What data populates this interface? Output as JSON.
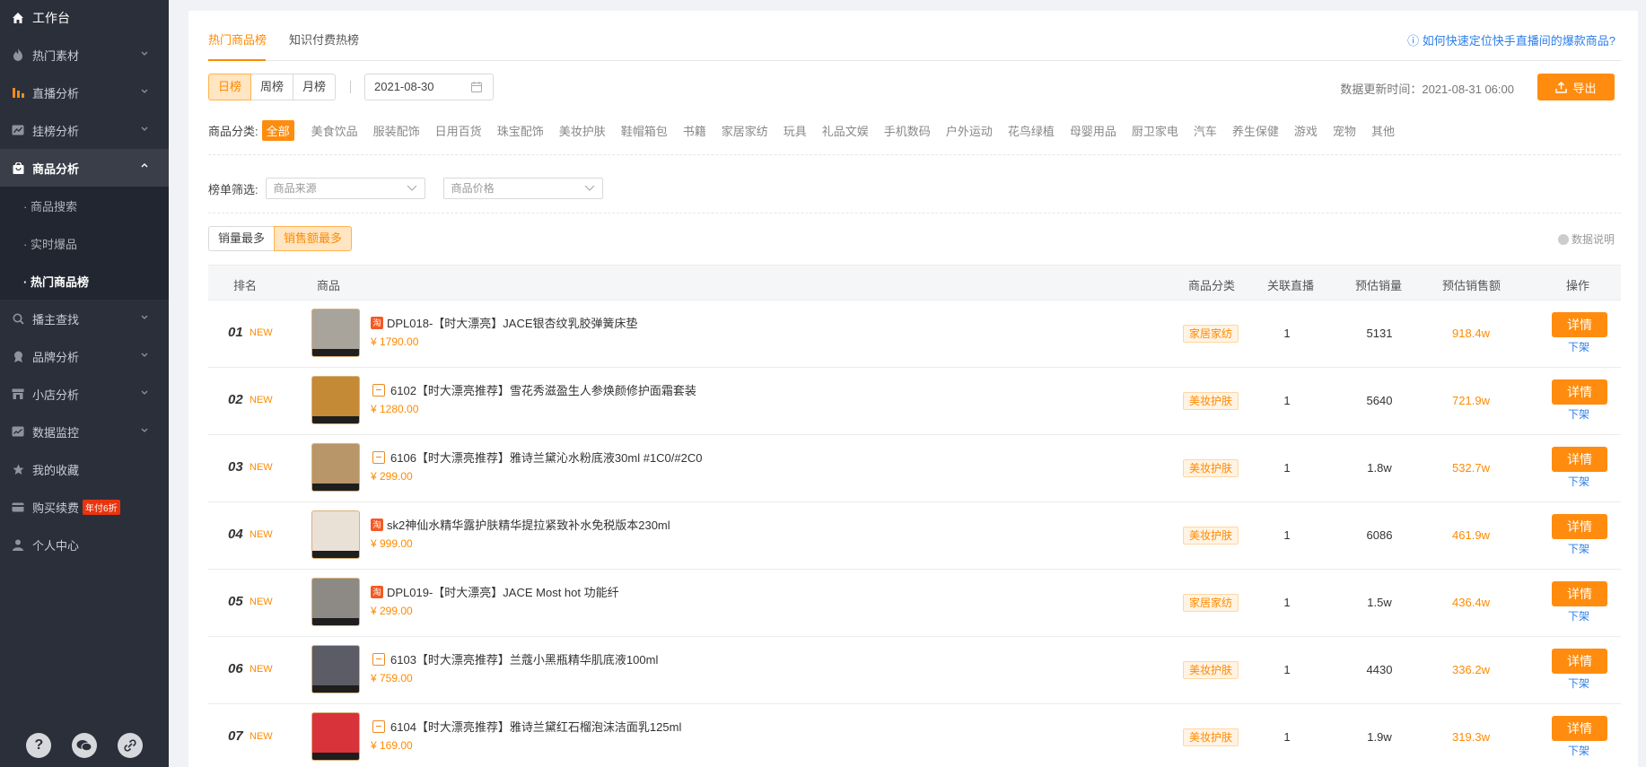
{
  "sidebar": {
    "workbench": "工作台",
    "items": [
      {
        "label": "热门素材",
        "icon": "flame-icon"
      },
      {
        "label": "直播分析",
        "icon": "bar-chart-icon"
      },
      {
        "label": "挂榜分析",
        "icon": "trend-chart-icon"
      },
      {
        "label": "商品分析",
        "icon": "shopping-bag-icon"
      }
    ],
    "sub_items": [
      {
        "label": "· 商品搜索"
      },
      {
        "label": "· 实时爆品"
      },
      {
        "label": "· 热门商品榜"
      }
    ],
    "items2": [
      {
        "label": "播主查找",
        "icon": "search-icon"
      },
      {
        "label": "品牌分析",
        "icon": "brand-icon"
      },
      {
        "label": "小店分析",
        "icon": "store-icon"
      },
      {
        "label": "数据监控",
        "icon": "monitor-icon"
      },
      {
        "label": "我的收藏",
        "icon": "star-icon"
      },
      {
        "label": "购买续费",
        "icon": "card-icon",
        "badge": "年付6折"
      },
      {
        "label": "个人中心",
        "icon": "user-icon"
      }
    ],
    "bottom_icons": [
      "help-icon",
      "wechat-icon",
      "link-icon"
    ]
  },
  "tabs": {
    "hot": "热门商品榜",
    "paid": "知识付费热榜",
    "help": "如何快速定位快手直播间的爆款商品?"
  },
  "controls": {
    "periods": [
      "日榜",
      "周榜",
      "月榜"
    ],
    "date": "2021-08-30",
    "update_label": "数据更新时间：2021-08-31 06:00",
    "export": "导出"
  },
  "categories": {
    "label": "商品分类:",
    "items": [
      "全部",
      "美食饮品",
      "服装配饰",
      "日用百货",
      "珠宝配饰",
      "美妆护肤",
      "鞋帽箱包",
      "书籍",
      "家居家纺",
      "玩具",
      "礼品文娱",
      "手机数码",
      "户外运动",
      "花鸟绿植",
      "母婴用品",
      "厨卫家电",
      "汽车",
      "养生保健",
      "游戏",
      "宠物",
      "其他"
    ]
  },
  "filters": {
    "label": "榜单筛选:",
    "source_placeholder": "商品来源",
    "price_placeholder": "商品价格"
  },
  "sort": {
    "options": [
      "销量最多",
      "销售额最多"
    ],
    "data_note": "数据说明"
  },
  "table": {
    "headers": {
      "rank": "排名",
      "product": "商品",
      "category": "商品分类",
      "live": "关联直播",
      "sales": "预估销量",
      "amount": "预估销售额",
      "action": "操作"
    },
    "new_label": "NEW",
    "detail_label": "详情",
    "off_label": "下架",
    "rows": [
      {
        "rank": "01",
        "source": "red",
        "title": "DPL018-【时大漂亮】JACE银杏纹乳胶弹簧床垫",
        "price": "¥ 1790.00",
        "category": "家居家纺",
        "live": "1",
        "sales": "5131",
        "amount": "918.4w",
        "thumb": "#a8a49c"
      },
      {
        "rank": "02",
        "source": "orange",
        "title": "6102【时大漂亮推荐】雪花秀滋盈生人参焕颜修护面霜套装",
        "price": "¥ 1280.00",
        "category": "美妆护肤",
        "live": "1",
        "sales": "5640",
        "amount": "721.9w",
        "thumb": "#c58a35"
      },
      {
        "rank": "03",
        "source": "orange",
        "title": "6106【时大漂亮推荐】雅诗兰黛沁水粉底液30ml #1C0/#2C0",
        "price": "¥ 299.00",
        "category": "美妆护肤",
        "live": "1",
        "sales": "1.8w",
        "amount": "532.7w",
        "thumb": "#b9956a"
      },
      {
        "rank": "04",
        "source": "red",
        "title": "sk2神仙水精华露护肤精华提拉紧致补水免税版本230ml",
        "price": "¥ 999.00",
        "category": "美妆护肤",
        "live": "1",
        "sales": "6086",
        "amount": "461.9w",
        "thumb": "#e9e1d6"
      },
      {
        "rank": "05",
        "source": "red",
        "title": "DPL019-【时大漂亮】JACE Most hot 功能纤",
        "price": "¥ 299.00",
        "category": "家居家纺",
        "live": "1",
        "sales": "1.5w",
        "amount": "436.4w",
        "thumb": "#8d8a86"
      },
      {
        "rank": "06",
        "source": "orange",
        "title": "6103【时大漂亮推荐】兰蔻小黑瓶精华肌底液100ml",
        "price": "¥ 759.00",
        "category": "美妆护肤",
        "live": "1",
        "sales": "4430",
        "amount": "336.2w",
        "thumb": "#5c5c66"
      },
      {
        "rank": "07",
        "source": "orange",
        "title": "6104【时大漂亮推荐】雅诗兰黛红石榴泡沫洁面乳125ml",
        "price": "¥ 169.00",
        "category": "美妆护肤",
        "live": "1",
        "sales": "1.9w",
        "amount": "319.3w",
        "thumb": "#d8323a"
      }
    ]
  },
  "colors": {
    "accent": "#ff8c0f",
    "link": "#2d7ee8",
    "sidebar_bg": "#2b2f3a"
  }
}
